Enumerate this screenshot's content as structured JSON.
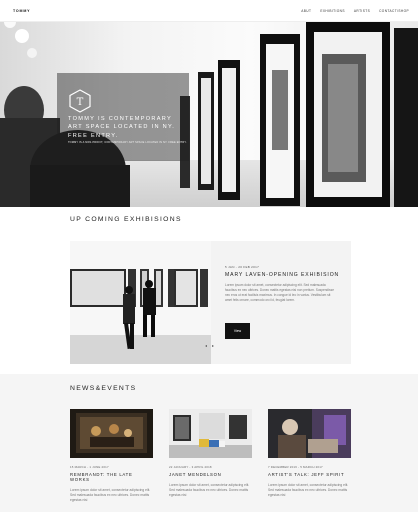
{
  "nav": {
    "logo": "TOMMY",
    "links": [
      "ABUT",
      "EXHIBITIONS",
      "ARTISTS",
      "CONTACT/SHOP"
    ]
  },
  "hero": {
    "icon_letter": "T",
    "title": "TOMMY IS CONTEMPORARY ART SPACE LOCATED IN NY. FREE ENTRY.",
    "subtitle": "TOMMY IS A NON-PROFIT, CONTEMPORARY ART SPACE LOCATED IN NY. FREE ENTRY."
  },
  "upcoming": {
    "title": "UP COMING EXHIBISIONS",
    "date": "5 JAN - 20 FEB 2017",
    "event": "MARY LAVEN-OPENING EXHIBISION",
    "description": "Lorem ipsum dolor sit amet, consectetur adipiscing elit. Sed malesuada faucibus ex nec ultrices. Donec mattis egestas nisi non pretium. Suspendisse nec eros ut erat facilisis maximus. In congue id leo in varius. Vestibulum sit amet felis ornare, commodo orci id, feugiat lorem.",
    "view_label": "View",
    "prev_arrow": "◂",
    "next_arrow": "▸"
  },
  "news": {
    "title": "NEWS&EVENTS",
    "items": [
      {
        "date": "15 MARCH - 1 JUNE 2017",
        "title": "REMBRANDT: THE LATE WORKS",
        "description": "Lorem ipsum dolor sit amet, consectetur adipiscing elit. Sed malesuada faucibus ex nec ultrices. Donec mattis egestas nisi"
      },
      {
        "date": "22 JANUARY - 3 APRIL 2018",
        "title": "JANET MENDELSON",
        "description": "Lorem ipsum dolor sit amet, consectetur adipiscing elit. Sed malesuada faucibus ex nec ultrices. Donec mattis egestas nisi"
      },
      {
        "date": "7 DECEMBER 2016 - 5 MARCH 2017",
        "title": "ARTIST'S TALK: JEFF SPIRIT",
        "description": "Lorem ipsum dolor sit amet, consectetur adipiscing elit. Sed malesuada faucibus ex nec ultrices. Donec mattis egestas nisi"
      }
    ]
  }
}
